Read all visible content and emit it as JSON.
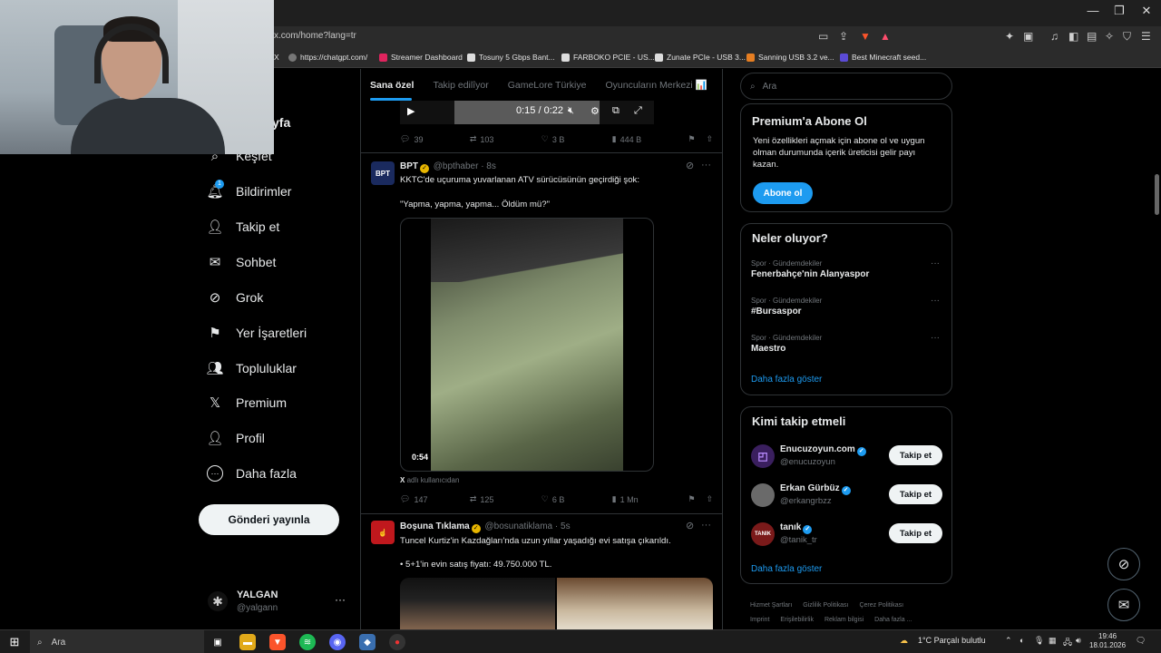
{
  "browser": {
    "url": "x.com/home?lang=tr",
    "window_controls": [
      "—",
      "❐",
      "✕"
    ],
    "bookmarks": [
      {
        "label": "X",
        "color": "#000000"
      },
      {
        "label": "https://chatgpt.com/",
        "color": "#777777"
      },
      {
        "label": "Streamer Dashboard",
        "color": "#e0245e"
      },
      {
        "label": "Tosuny 5 Gbps Bant...",
        "color": "#dddddd"
      },
      {
        "label": "FARBOKO PCIE - US...",
        "color": "#dddddd"
      },
      {
        "label": "Zunate PCIe - USB 3...",
        "color": "#dddddd"
      },
      {
        "label": "Sanning USB 3.2 ve...",
        "color": "#e67e22"
      },
      {
        "label": "Best Minecraft seed...",
        "color": "#5b4bd6"
      }
    ]
  },
  "nav": {
    "home_partial": "yfa",
    "items": [
      {
        "label": "Keşfet",
        "icon": "search-icon",
        "glyph": "⌕"
      },
      {
        "label": "Bildirimler",
        "icon": "bell-icon",
        "glyph": "🔔︎",
        "badge": "1"
      },
      {
        "label": "Takip et",
        "icon": "person-add-icon",
        "glyph": "👤︎"
      },
      {
        "label": "Sohbet",
        "icon": "mail-icon",
        "glyph": "✉"
      },
      {
        "label": "Grok",
        "icon": "grok-icon",
        "glyph": "⊘"
      },
      {
        "label": "Yer İşaretleri",
        "icon": "bookmark-icon",
        "glyph": "⚑"
      },
      {
        "label": "Topluluklar",
        "icon": "communities-icon",
        "glyph": "👥︎"
      },
      {
        "label": "Premium",
        "icon": "x-logo-icon",
        "glyph": "𝕏"
      },
      {
        "label": "Profil",
        "icon": "profile-icon",
        "glyph": "👤︎"
      },
      {
        "label": "Daha fazla",
        "icon": "more-circle-icon",
        "glyph": "⋯"
      }
    ],
    "post_button": "Gönderi yayınla",
    "profile": {
      "name": "YALGAN",
      "handle": "@yalgann",
      "more": "···"
    }
  },
  "feed": {
    "tabs": [
      "Sana özel",
      "Takip edilîyor",
      "GameLore Türkiye",
      "Oyuncuların Merkezi 📊"
    ],
    "prev_post": {
      "time_display": "0:15 / 0:22",
      "replies": "39",
      "reposts": "103",
      "likes": "3 B",
      "views": "444 B"
    },
    "post1": {
      "avatar_text": "BPT",
      "author": "BPT",
      "meta": "@bpthaber · 8s",
      "text1": "KKTC'de uçuruma yuvarlanan ATV sürücüsünün geçirdiği şok:",
      "text2": "\"Yapma, yapma, yapma... Öldüm mü?\"",
      "duration": "0:54",
      "caption_x": "X",
      "caption": "adlı kullanıcıdan",
      "replies": "147",
      "reposts": "125",
      "likes": "6 B",
      "views": "1 Mn"
    },
    "post2": {
      "author": "Boşuna Tıklama",
      "meta": "@bosunatiklama · 5s",
      "text1": "Tuncel Kurtiz'in Kazdağları'nda uzun yıllar yaşadığı evi satışa çıkarıldı.",
      "text2": "• 5+1'in evin satış fiyatı: 49.750.000 TL."
    }
  },
  "right": {
    "search_placeholder": "Ara",
    "premium": {
      "title": "Premium'a Abone Ol",
      "text": "Yeni özellikleri açmak için abone ol ve uygun olman durumunda içerik üreticisi gelir payı kazan.",
      "button": "Abone ol"
    },
    "trends": {
      "title": "Neler oluyor?",
      "items": [
        {
          "category": "Spor · Gündemdekiler",
          "name": "Fenerbahçe'nin Alanyaspor"
        },
        {
          "category": "Spor · Gündemdekiler",
          "name": "#Bursaspor"
        },
        {
          "category": "Spor · Gündemdekiler",
          "name": "Maestro"
        }
      ],
      "more": "Daha fazla göster"
    },
    "who_to_follow": {
      "title": "Kimi takip etmeli",
      "items": [
        {
          "name": "Enucuzoyun.com",
          "handle": "@enucuzoyun",
          "button": "Takip et",
          "avatar_color": "#3a1f5e"
        },
        {
          "name": "Erkan Gürbüz",
          "handle": "@erkangrbzz",
          "button": "Takip et",
          "avatar_color": "#666666"
        },
        {
          "name": "tanık",
          "handle": "@tanik_tr",
          "button": "Takip et",
          "avatar_color": "#7a1a1a",
          "avatar_text": "TANIK"
        }
      ],
      "more": "Daha fazla göster"
    },
    "footer": [
      "Hizmet Şartları",
      "Gizlilik Politikası",
      "Çerez Politikası",
      "Imprint",
      "Erişilebilirlik",
      "Reklam bilgisi",
      "Daha fazla ..."
    ]
  },
  "taskbar": {
    "search_placeholder": "Ara",
    "weather": "1°C  Parçalı bulutlu",
    "time": "19:46",
    "date": "18.01.2026"
  }
}
